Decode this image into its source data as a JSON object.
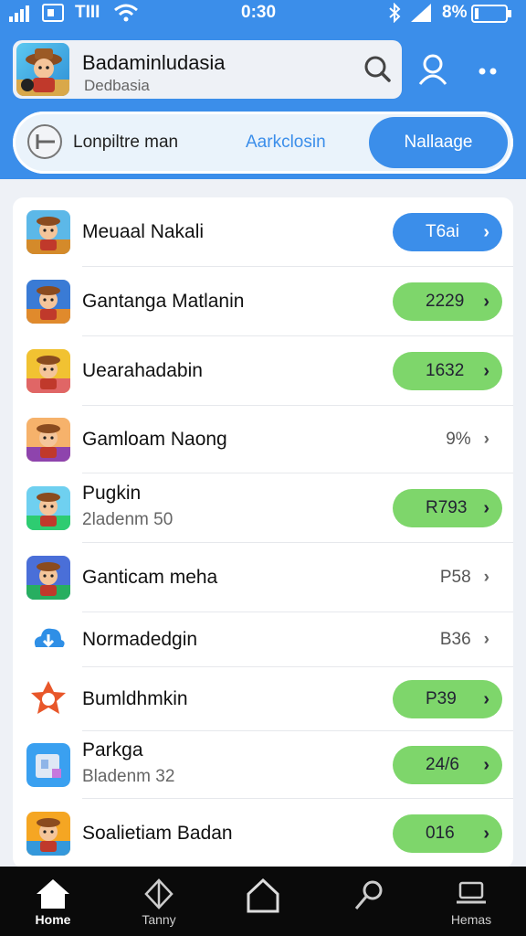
{
  "status_bar": {
    "time": "0:30",
    "carrier": "TIII",
    "battery": "8%"
  },
  "header": {
    "title": "Badaminludasia",
    "subtitle": "Dedbasia"
  },
  "segments": {
    "first": "Lonpiltre man",
    "second": "Aarkclosin",
    "active": "Nallaage"
  },
  "list": [
    {
      "title": "Meuaal Nakali",
      "badge": "T6ai",
      "badge_style": "blue"
    },
    {
      "title": "Gantanga Matlanin",
      "badge": "2229",
      "badge_style": "green"
    },
    {
      "title": "Uearahadabin",
      "badge": "1632",
      "badge_style": "green"
    },
    {
      "title": "Gamloam Naong",
      "badge": "9%",
      "badge_style": "plain"
    },
    {
      "title": "Pugkin",
      "subtitle": "2ladenm 50",
      "badge": "R793",
      "badge_style": "green"
    },
    {
      "title": "Ganticam meha",
      "badge": "P58",
      "badge_style": "plain"
    },
    {
      "title": "Normadedgin",
      "badge": "B36",
      "badge_style": "plain"
    },
    {
      "title": "Bumldhmkin",
      "badge": "P39",
      "badge_style": "green"
    },
    {
      "title": "Parkga",
      "subtitle": "Bladenm 32",
      "badge": "24/6",
      "badge_style": "green"
    },
    {
      "title": "Soalietiam Badan",
      "badge": "016",
      "badge_style": "green"
    }
  ],
  "nav": [
    {
      "label": "Home",
      "icon": "home-icon"
    },
    {
      "label": "Tanny",
      "icon": "diamond-icon"
    },
    {
      "label": "",
      "icon": "house-outline-icon"
    },
    {
      "label": "",
      "icon": "search-icon"
    },
    {
      "label": "Hemas",
      "icon": "laptop-icon"
    }
  ],
  "colors": {
    "primary": "#3b8eea",
    "green_badge": "#7ed66b",
    "nav_bg": "#0a0a0a"
  }
}
